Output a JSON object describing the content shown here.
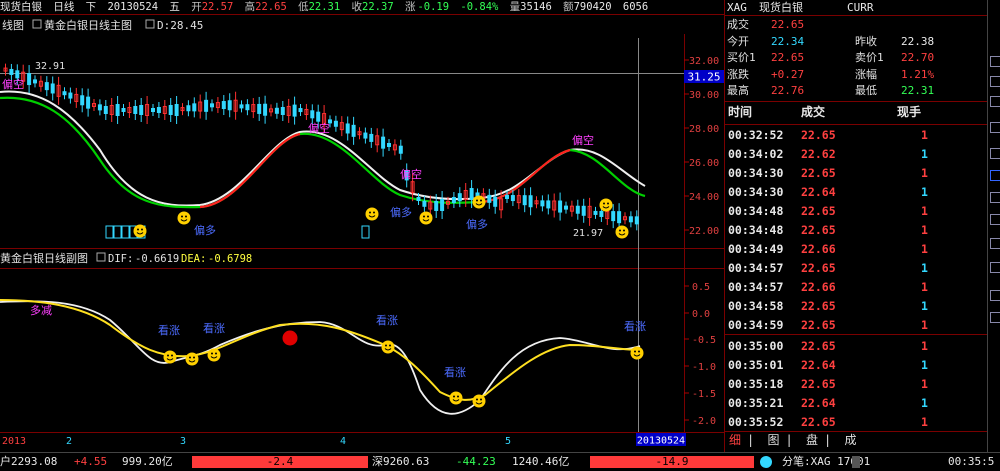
{
  "topbar": {
    "name": "现货白银",
    "period": "日线",
    "dir": "下",
    "date": "20130524",
    "weekday": "五",
    "open_label": "开",
    "open": "22.57",
    "high_label": "高",
    "high": "22.65",
    "low_label": "低",
    "low": "22.31",
    "close_label": "收",
    "close": "22.37",
    "change_label": "涨",
    "change": "-0.19",
    "change_pct": "-0.84%",
    "vol_label": "量",
    "vol": "35146",
    "amt_label": "额",
    "amt": "790420",
    "extra": "6056"
  },
  "main_chart": {
    "title": "黄金白银日线主图",
    "d_label": "D:28.45",
    "left_label": "线图",
    "current_price": "31.25",
    "low_marker": "21.97",
    "high_marker": "32.91",
    "y_ticks": [
      "32.00",
      "30.00",
      "28.00",
      "26.00",
      "24.00",
      "22.00"
    ],
    "annotations": [
      "偏空",
      "偏空",
      "偏空",
      "偏多",
      "偏多",
      "偏多",
      "偏空"
    ]
  },
  "sub_chart": {
    "title": "黄金白银日线副图",
    "dif_label": "DIF:",
    "dif": "-0.6619",
    "dea_label": "DEA:",
    "dea": "-0.6798",
    "y_ticks": [
      "0.5",
      "0.0",
      "-0.5",
      "-1.0",
      "-1.5",
      "-2.0"
    ],
    "annotations": [
      "多减",
      "看涨",
      "看涨",
      "看涨",
      "看涨",
      "看涨"
    ]
  },
  "x_axis": {
    "labels": [
      "2013",
      "2",
      "3",
      "4",
      "5"
    ],
    "current_date": "20130524"
  },
  "quote": {
    "code": "XAG",
    "name": "现货白银",
    "market": "CURR",
    "rows": [
      {
        "l1": "成交",
        "v1": "22.65",
        "l2": "",
        "v2": ""
      },
      {
        "l1": "今开",
        "v1": "22.34",
        "l2": "昨收",
        "v2": "22.38"
      },
      {
        "l1": "买价1",
        "v1": "22.65",
        "l2": "卖价1",
        "v2": "22.70"
      },
      {
        "l1": "涨跌",
        "v1": "+0.27",
        "l2": "涨幅",
        "v2": "1.21%"
      },
      {
        "l1": "最高",
        "v1": "22.76",
        "l2": "最低",
        "v2": "22.31"
      }
    ]
  },
  "trades": {
    "headers": [
      "时间",
      "成交",
      "现手"
    ],
    "rows": [
      {
        "t": "00:32:52",
        "p": "22.65",
        "pc": "#ff4040",
        "v": "1",
        "vc": "#ff4040"
      },
      {
        "t": "00:34:02",
        "p": "22.62",
        "pc": "#ff4040",
        "v": "1",
        "vc": "#33d8ff"
      },
      {
        "t": "00:34:30",
        "p": "22.65",
        "pc": "#ff4040",
        "v": "1",
        "vc": "#ff4040"
      },
      {
        "t": "00:34:30",
        "p": "22.64",
        "pc": "#ff4040",
        "v": "1",
        "vc": "#33d8ff"
      },
      {
        "t": "00:34:48",
        "p": "22.65",
        "pc": "#ff4040",
        "v": "1",
        "vc": "#ff4040"
      },
      {
        "t": "00:34:48",
        "p": "22.65",
        "pc": "#ff4040",
        "v": "1",
        "vc": "#ff4040"
      },
      {
        "t": "00:34:49",
        "p": "22.66",
        "pc": "#ff4040",
        "v": "1",
        "vc": "#ff4040"
      },
      {
        "t": "00:34:57",
        "p": "22.65",
        "pc": "#ff4040",
        "v": "1",
        "vc": "#33d8ff"
      },
      {
        "t": "00:34:57",
        "p": "22.66",
        "pc": "#ff4040",
        "v": "1",
        "vc": "#ff4040"
      },
      {
        "t": "00:34:58",
        "p": "22.65",
        "pc": "#ff4040",
        "v": "1",
        "vc": "#33d8ff"
      },
      {
        "t": "00:34:59",
        "p": "22.65",
        "pc": "#ff4040",
        "v": "1",
        "vc": "#ff4040"
      },
      {
        "t": "00:35:00",
        "p": "22.65",
        "pc": "#ff4040",
        "v": "1",
        "vc": "#ff4040"
      },
      {
        "t": "00:35:01",
        "p": "22.64",
        "pc": "#ff4040",
        "v": "1",
        "vc": "#33d8ff"
      },
      {
        "t": "00:35:18",
        "p": "22.65",
        "pc": "#ff4040",
        "v": "1",
        "vc": "#ff4040"
      },
      {
        "t": "00:35:21",
        "p": "22.64",
        "pc": "#ff4040",
        "v": "1",
        "vc": "#33d8ff"
      },
      {
        "t": "00:35:52",
        "p": "22.65",
        "pc": "#ff4040",
        "v": "1",
        "vc": "#ff4040"
      }
    ]
  },
  "tabs": [
    "细",
    "图",
    "盘",
    "成"
  ],
  "bottombar": {
    "a1": "户2293.08",
    "a2": "+4.55",
    "a3": "999.20亿",
    "bar1": "-2.4",
    "b1": "深9260.63",
    "b2": "-44.23",
    "b3": "1240.46亿",
    "bar2": "-14.9",
    "ticker": "分笔:XAG 17601",
    "clock": "00:35:5"
  }
}
